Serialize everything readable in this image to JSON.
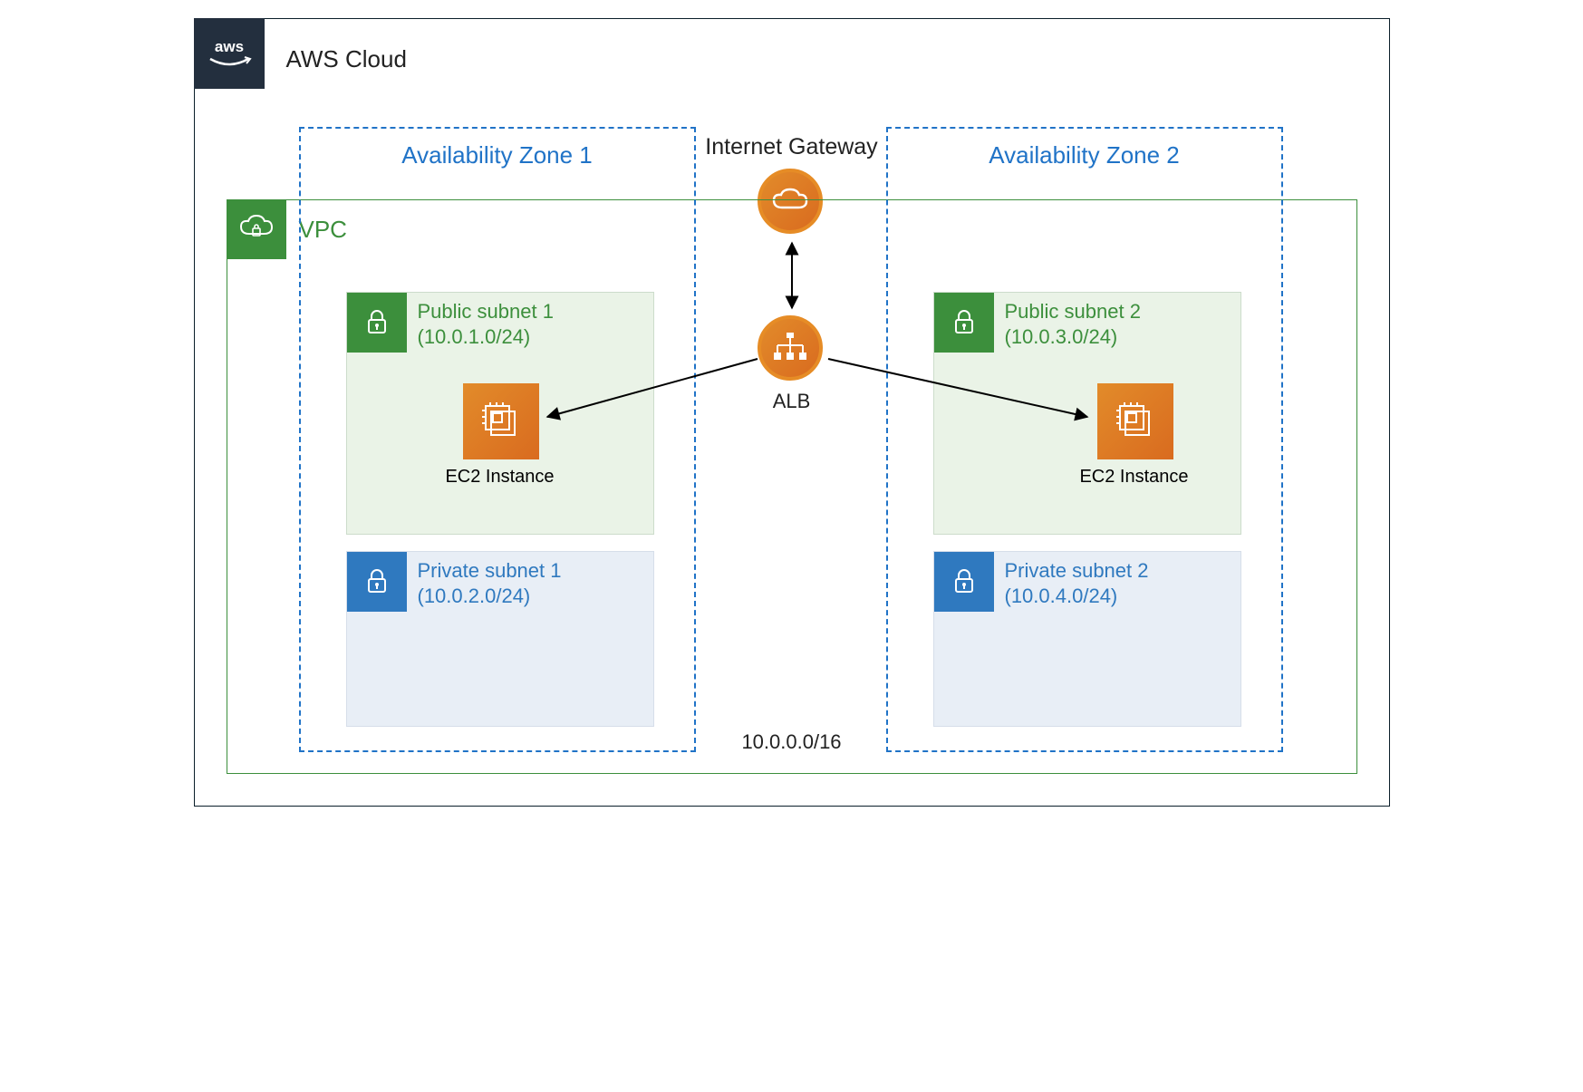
{
  "cloud": {
    "title": "AWS Cloud",
    "logo": "aws"
  },
  "vpc": {
    "title": "VPC",
    "cidr": "10.0.0.0/16"
  },
  "igw": {
    "label": "Internet Gateway"
  },
  "alb": {
    "label": "ALB"
  },
  "az": [
    {
      "title": "Availability Zone 1",
      "public_subnet": {
        "name": "Public subnet 1",
        "cidr": "(10.0.1.0/24)",
        "ec2_label": "EC2 Instance"
      },
      "private_subnet": {
        "name": "Private subnet 1",
        "cidr": "(10.0.2.0/24)"
      }
    },
    {
      "title": "Availability Zone 2",
      "public_subnet": {
        "name": "Public subnet 2",
        "cidr": "(10.0.3.0/24)",
        "ec2_label": "EC2 Instance"
      },
      "private_subnet": {
        "name": "Private subnet 2",
        "cidr": "(10.0.4.0/24)"
      }
    }
  ],
  "chart_data": {
    "type": "diagram",
    "title": "AWS Cloud",
    "nodes": [
      {
        "id": "cloud",
        "label": "AWS Cloud",
        "kind": "boundary"
      },
      {
        "id": "vpc",
        "label": "VPC",
        "cidr": "10.0.0.0/16",
        "kind": "boundary",
        "parent": "cloud"
      },
      {
        "id": "az1",
        "label": "Availability Zone 1",
        "kind": "boundary",
        "parent": "vpc"
      },
      {
        "id": "az2",
        "label": "Availability Zone 2",
        "kind": "boundary",
        "parent": "vpc"
      },
      {
        "id": "pub1",
        "label": "Public subnet 1",
        "cidr": "10.0.1.0/24",
        "kind": "subnet-public",
        "parent": "az1"
      },
      {
        "id": "priv1",
        "label": "Private subnet 1",
        "cidr": "10.0.2.0/24",
        "kind": "subnet-private",
        "parent": "az1"
      },
      {
        "id": "pub2",
        "label": "Public subnet 2",
        "cidr": "10.0.3.0/24",
        "kind": "subnet-public",
        "parent": "az2"
      },
      {
        "id": "priv2",
        "label": "Private subnet 2",
        "cidr": "10.0.4.0/24",
        "kind": "subnet-private",
        "parent": "az2"
      },
      {
        "id": "igw",
        "label": "Internet Gateway",
        "kind": "gateway",
        "parent": "vpc"
      },
      {
        "id": "alb",
        "label": "ALB",
        "kind": "load-balancer",
        "parent": "vpc"
      },
      {
        "id": "ec2a",
        "label": "EC2 Instance",
        "kind": "ec2",
        "parent": "pub1"
      },
      {
        "id": "ec2b",
        "label": "EC2 Instance",
        "kind": "ec2",
        "parent": "pub2"
      }
    ],
    "edges": [
      {
        "from": "igw",
        "to": "alb",
        "directed": "both"
      },
      {
        "from": "alb",
        "to": "ec2a",
        "directed": "forward"
      },
      {
        "from": "alb",
        "to": "ec2b",
        "directed": "forward"
      }
    ]
  }
}
